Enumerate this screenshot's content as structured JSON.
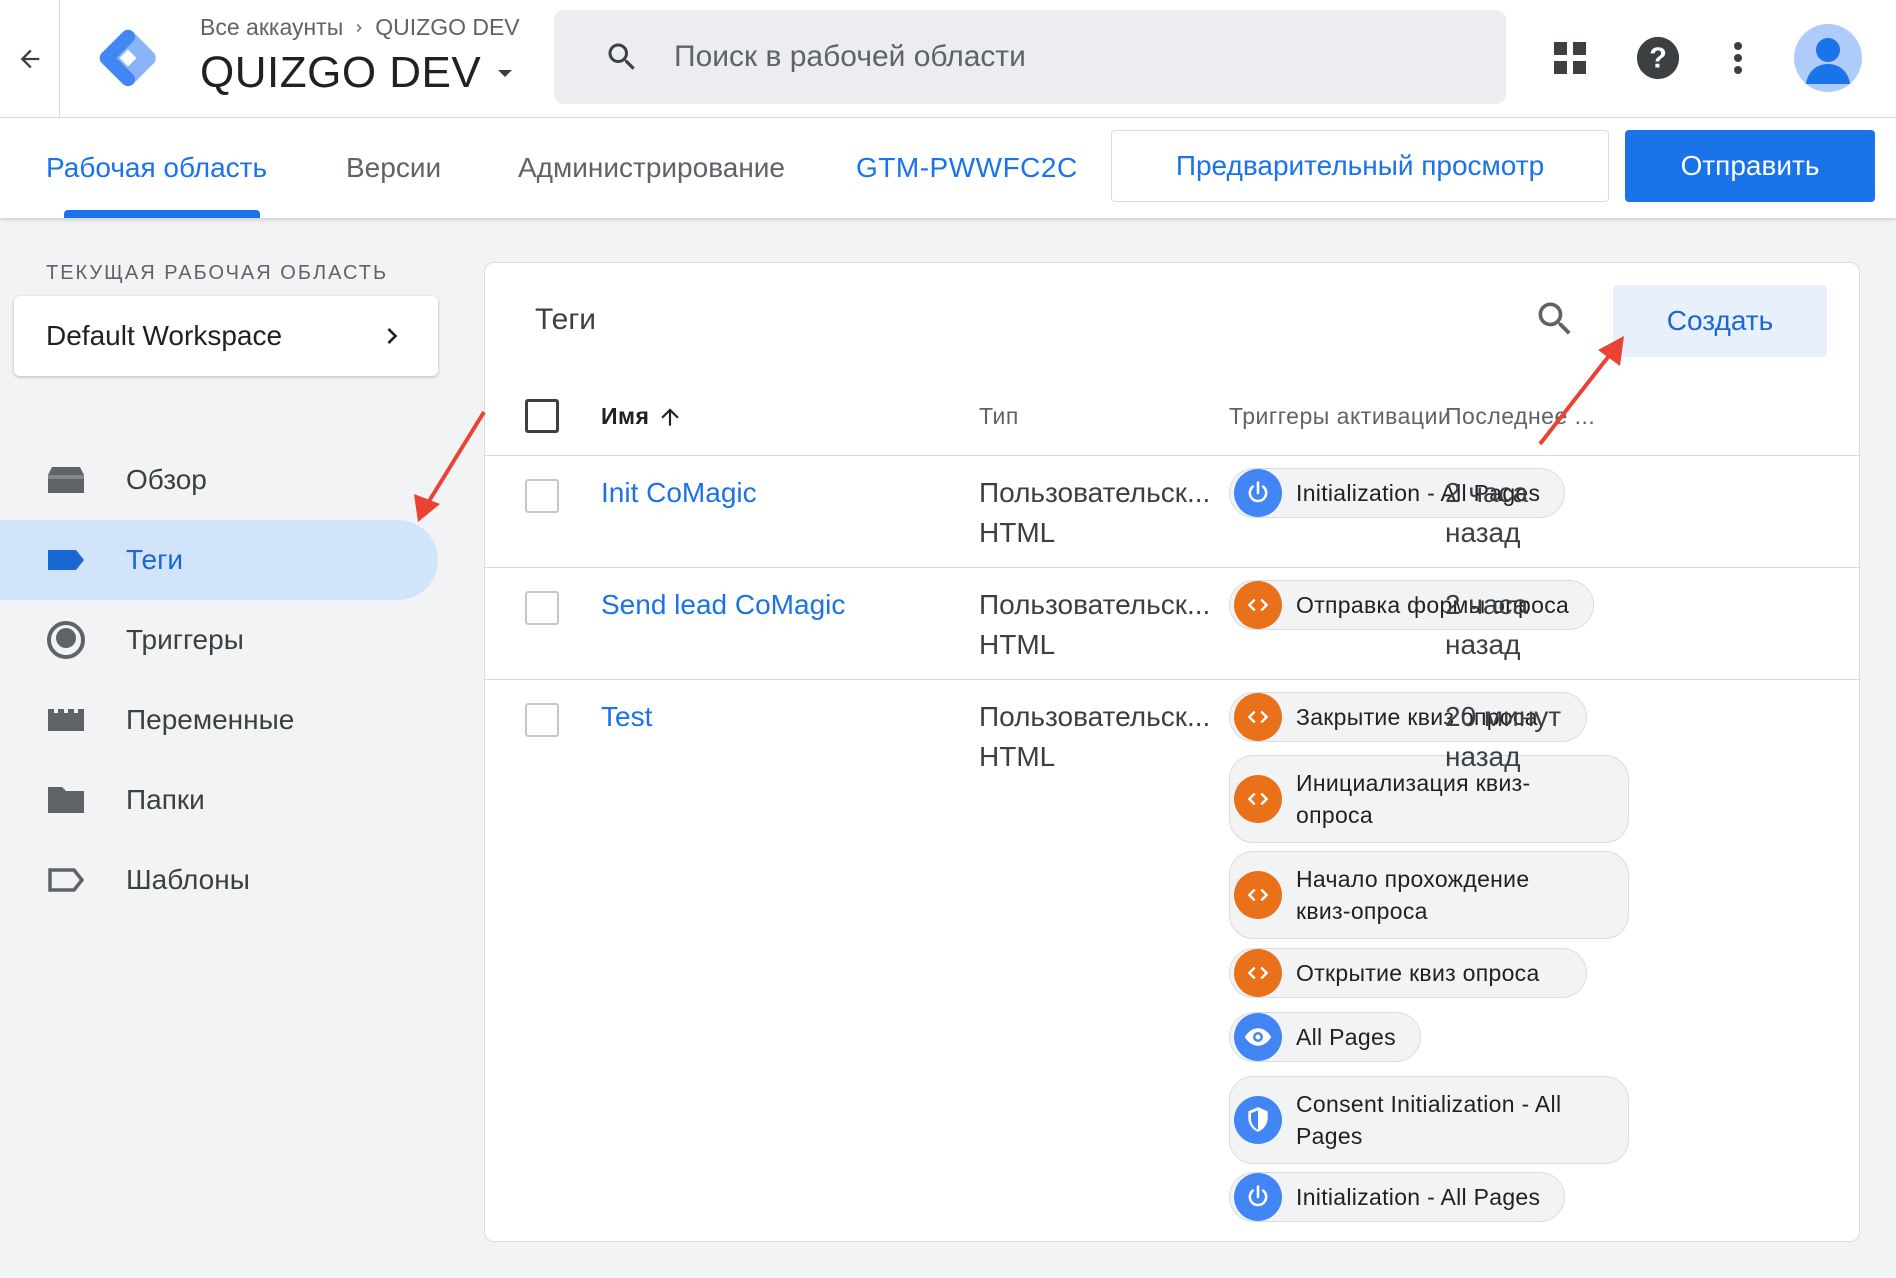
{
  "header": {
    "breadcrumb_account": "Все аккаунты",
    "breadcrumb_container": "QUIZGO DEV",
    "container_name": "QUIZGO DEV",
    "search_placeholder": "Поиск в рабочей области"
  },
  "nav": {
    "tabs": [
      "Рабочая область",
      "Версии",
      "Администрирование"
    ],
    "container_id": "GTM-PWWFC2C",
    "preview_label": "Предварительный просмотр",
    "submit_label": "Отправить"
  },
  "sidebar": {
    "workspace_label": "ТЕКУЩАЯ РАБОЧАЯ ОБЛАСТЬ",
    "workspace_name": "Default Workspace",
    "items": [
      {
        "label": "Обзор",
        "icon": "overview-icon"
      },
      {
        "label": "Теги",
        "icon": "tag-icon",
        "active": true
      },
      {
        "label": "Триггеры",
        "icon": "trigger-icon"
      },
      {
        "label": "Переменные",
        "icon": "variables-icon"
      },
      {
        "label": "Папки",
        "icon": "folder-icon"
      },
      {
        "label": "Шаблоны",
        "icon": "template-icon"
      }
    ]
  },
  "tags_panel": {
    "title": "Теги",
    "create_label": "Создать",
    "columns": {
      "name": "Имя",
      "type": "Тип",
      "triggers": "Триггеры активации",
      "last_edited": "Последнее ..."
    },
    "rows": [
      {
        "name": "Init CoMagic",
        "type_line1": "Пользовательск...",
        "type_line2": "HTML",
        "time_line1": "2 часа",
        "time_line2": "назад",
        "triggers": [
          {
            "label": "Initialization - All Pages",
            "icon": "power-icon",
            "color": "#4285f4"
          }
        ]
      },
      {
        "name": "Send lead CoMagic",
        "type_line1": "Пользовательск...",
        "type_line2": "HTML",
        "time_line1": "2 часа",
        "time_line2": "назад",
        "triggers": [
          {
            "label": "Отправка формы опроса",
            "icon": "code-icon",
            "color": "#e8711a"
          }
        ]
      },
      {
        "name": "Test",
        "type_line1": "Пользовательск...",
        "type_line2": "HTML",
        "time_line1": "20 минут",
        "time_line2": "назад",
        "triggers": [
          {
            "label": "Закрытие квиз опроса",
            "icon": "code-icon",
            "color": "#e8711a"
          },
          {
            "label": "Инициализация квиз-опроса",
            "icon": "code-icon",
            "color": "#e8711a"
          },
          {
            "label": "Начало прохождение квиз-опроса",
            "icon": "code-icon",
            "color": "#e8711a"
          },
          {
            "label": "Открытие квиз опроса",
            "icon": "code-icon",
            "color": "#e8711a"
          },
          {
            "label": "All Pages",
            "icon": "eye-icon",
            "color": "#4285f4"
          },
          {
            "label": "Consent Initialization - All Pages",
            "icon": "shield-icon",
            "color": "#4285f4"
          },
          {
            "label": "Initialization - All Pages",
            "icon": "power-icon",
            "color": "#4285f4"
          }
        ]
      }
    ]
  },
  "colors": {
    "accent": "#1a73e8",
    "annotation_arrow": "#ea4335"
  }
}
